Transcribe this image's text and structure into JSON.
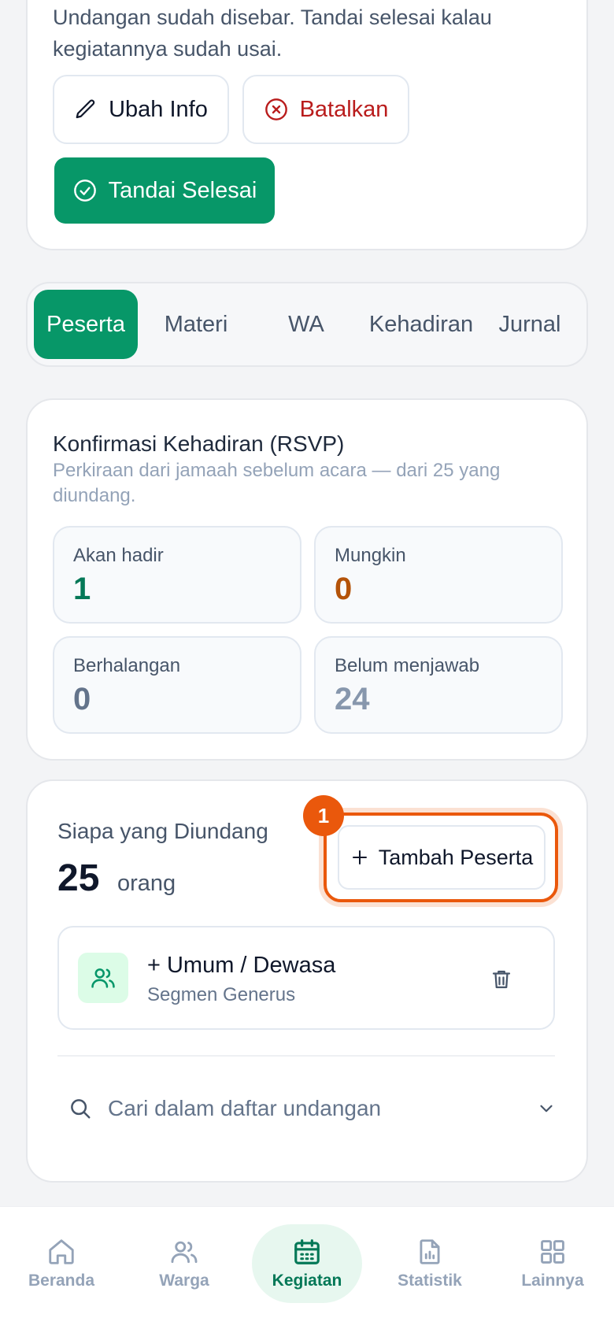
{
  "top_card": {
    "description": "Undangan sudah disebar. Tandai selesai kalau kegiatannya sudah usai.",
    "edit_label": "Ubah Info",
    "cancel_label": "Batalkan",
    "done_label": "Tandai Selesai"
  },
  "tabs": [
    {
      "label": "Peserta",
      "active": true
    },
    {
      "label": "Materi",
      "active": false
    },
    {
      "label": "WA",
      "active": false
    },
    {
      "label": "Kehadiran",
      "active": false
    },
    {
      "label": "Jurnal",
      "active": false
    }
  ],
  "rsvp": {
    "title": "Konfirmasi Kehadiran (RSVP)",
    "subtitle": "Perkiraan dari jamaah sebelum acara — dari 25 yang diundang.",
    "stats": [
      {
        "label": "Akan hadir",
        "value": "1",
        "color": "#047857"
      },
      {
        "label": "Mungkin",
        "value": "0",
        "color": "#b45309"
      },
      {
        "label": "Berhalangan",
        "value": "0",
        "color": "#64748b"
      },
      {
        "label": "Belum menjawab",
        "value": "24",
        "color": "#8797ad"
      }
    ]
  },
  "invited": {
    "title": "Siapa yang Diundang",
    "count": "25",
    "unit": "orang",
    "add_label": "Tambah Peserta",
    "badge": "1",
    "segment": {
      "name": "+ Umum / Dewasa",
      "sub": "Segmen Generus",
      "icon": "users-icon"
    },
    "search_placeholder": "Cari dalam daftar undangan"
  },
  "bottom_nav": [
    {
      "label": "Beranda",
      "icon": "home-icon",
      "active": false
    },
    {
      "label": "Warga",
      "icon": "users-icon",
      "active": false
    },
    {
      "label": "Kegiatan",
      "icon": "calendar-icon",
      "active": true
    },
    {
      "label": "Statistik",
      "icon": "chart-icon",
      "active": false
    },
    {
      "label": "Lainnya",
      "icon": "grid-icon",
      "active": false
    }
  ],
  "colors": {
    "primary": "#079768",
    "danger": "#b91c1c",
    "highlight": "#ea580c"
  }
}
